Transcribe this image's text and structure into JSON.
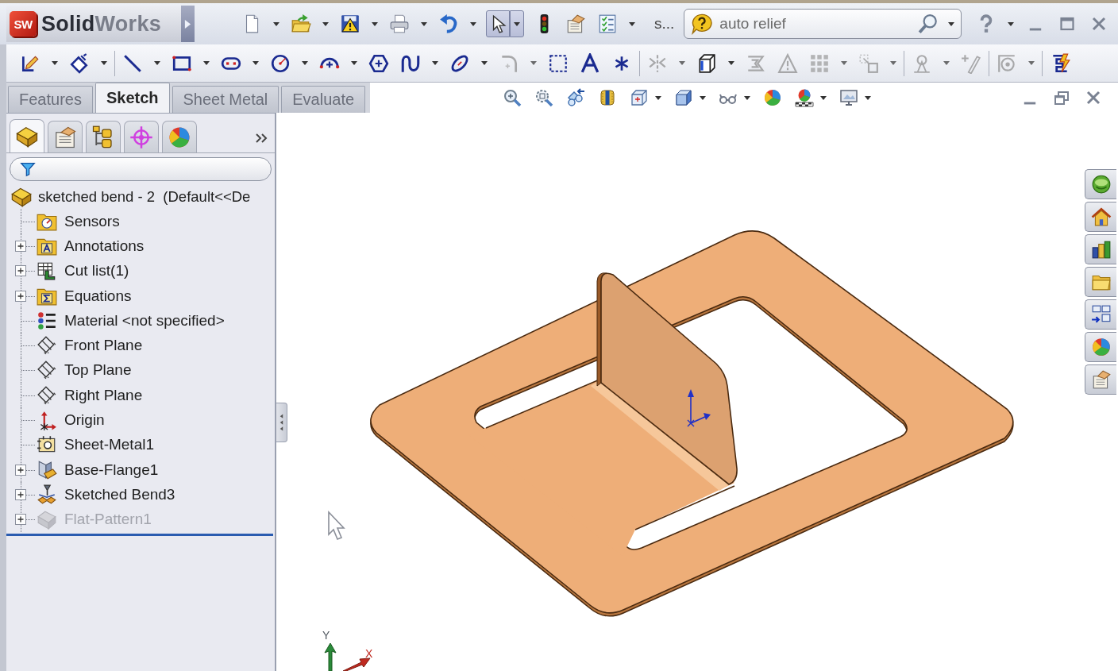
{
  "title_bar": {
    "logo_mark": "SW",
    "logo": "**Solid**Works",
    "tools": [
      {
        "dropdown": true,
        "pressed": false
      },
      {
        "dropdown": true,
        "pressed": false
      },
      {
        "dropdown": true,
        "pressed": false
      },
      {
        "dropdown": true,
        "pressed": false
      },
      {
        "dropdown": true,
        "pressed": false
      },
      {
        "dropdown": true,
        "pressed": true
      },
      {
        "dropdown": false,
        "pressed": false
      },
      {
        "dropdown": false,
        "pressed": false
      },
      {
        "dropdown": true,
        "pressed": false
      }
    ],
    "overflow_label": "s...",
    "search": {
      "value": "auto relief"
    }
  },
  "sketch_toolbar": {
    "groups": [
      [
        {
          "dropdown": true,
          "disabled": false
        },
        {
          "dropdown": true,
          "disabled": false
        }
      ],
      [
        {
          "dropdown": true,
          "disabled": false
        },
        {
          "dropdown": true,
          "disabled": false
        },
        {
          "dropdown": true,
          "disabled": false
        },
        {
          "dropdown": true,
          "disabled": false
        },
        {
          "dropdown": true,
          "disabled": false
        },
        {
          "dropdown": false,
          "disabled": false
        },
        {
          "dropdown": true,
          "disabled": false
        },
        {
          "dropdown": true,
          "disabled": false
        },
        {
          "dropdown": true,
          "disabled": true
        },
        {
          "dropdown": false,
          "disabled": false
        },
        {
          "dropdown": false,
          "disabled": false
        },
        {
          "dropdown": false,
          "disabled": false
        }
      ],
      [
        {
          "dropdown": true,
          "disabled": true
        },
        {
          "dropdown": true,
          "disabled": false
        },
        {
          "dropdown": false,
          "disabled": true
        },
        {
          "dropdown": false,
          "disabled": true
        },
        {
          "dropdown": true,
          "disabled": true
        },
        {
          "dropdown": true,
          "disabled": true
        }
      ],
      [
        {
          "dropdown": true,
          "disabled": true
        },
        {
          "dropdown": false,
          "disabled": true
        }
      ],
      [
        {
          "dropdown": true,
          "disabled": true
        }
      ],
      [
        {
          "dropdown": false,
          "disabled": false
        }
      ]
    ]
  },
  "command_tabs": [
    {
      "label": "Features",
      "selected": false
    },
    {
      "label": "Sketch",
      "selected": true
    },
    {
      "label": "Sheet Metal",
      "selected": false
    },
    {
      "label": "Evaluate",
      "selected": false
    }
  ],
  "view_toolbar": {
    "tools": [
      {
        "dropdown": false
      },
      {
        "dropdown": false
      },
      {
        "dropdown": false
      },
      {
        "dropdown": false
      },
      {
        "dropdown": true
      },
      {
        "dropdown": true
      },
      {
        "dropdown": true
      },
      {
        "dropdown": false
      },
      {
        "dropdown": true
      },
      {
        "dropdown": true
      }
    ]
  },
  "feature_manager": {
    "panel_tabs": [
      {
        "selected": true
      },
      {
        "selected": false
      },
      {
        "selected": false
      },
      {
        "selected": false
      },
      {
        "selected": false
      }
    ],
    "tree": {
      "label": "sketched bend - 2  (Default<<De",
      "children": [
        {
          "label": "Sensors",
          "expandable": false,
          "suppressed": false
        },
        {
          "label": "Annotations",
          "expandable": true,
          "suppressed": false
        },
        {
          "label": "Cut list(1)",
          "expandable": true,
          "suppressed": false
        },
        {
          "label": "Equations",
          "expandable": true,
          "suppressed": false
        },
        {
          "label": "Material <not specified>",
          "expandable": false,
          "suppressed": false
        },
        {
          "label": "Front Plane",
          "expandable": false,
          "suppressed": false
        },
        {
          "label": "Top Plane",
          "expandable": false,
          "suppressed": false
        },
        {
          "label": "Right Plane",
          "expandable": false,
          "suppressed": false
        },
        {
          "label": "Origin",
          "expandable": false,
          "suppressed": false
        },
        {
          "label": "Sheet-Metal1",
          "expandable": false,
          "suppressed": false
        },
        {
          "label": "Base-Flange1",
          "expandable": true,
          "suppressed": false
        },
        {
          "label": "Sketched Bend3",
          "expandable": true,
          "suppressed": false
        },
        {
          "label": "Flat-Pattern1",
          "expandable": true,
          "suppressed": true
        }
      ]
    }
  },
  "graphics": {
    "triad": {
      "y_label": "Y",
      "x_label": "X"
    }
  }
}
